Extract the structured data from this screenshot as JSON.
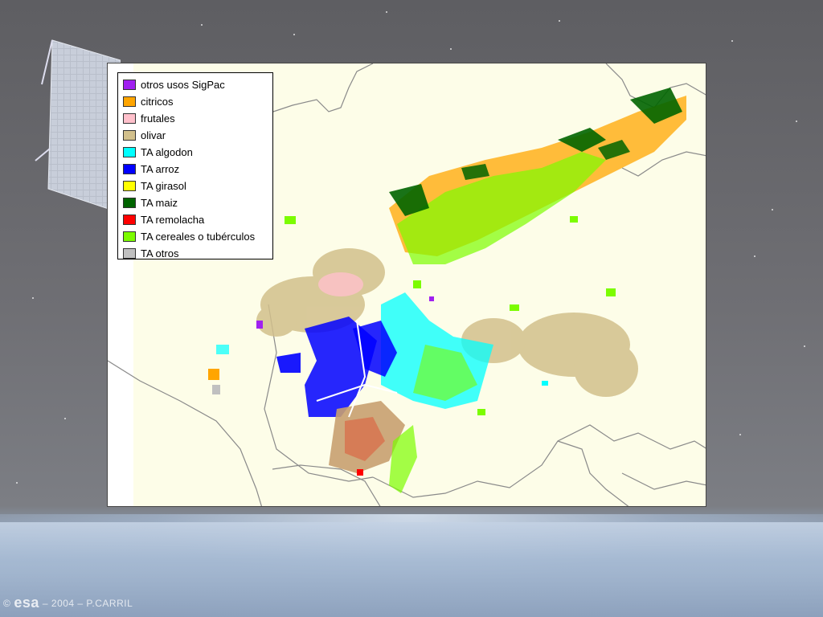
{
  "map": {
    "legend": [
      {
        "label": "otros usos SigPac",
        "color": "#a020f0"
      },
      {
        "label": "citricos",
        "color": "#ffa500"
      },
      {
        "label": "frutales",
        "color": "#ffc0cb"
      },
      {
        "label": "olivar",
        "color": "#d2c08c"
      },
      {
        "label": "TA algodon",
        "color": "#00ffff"
      },
      {
        "label": "TA arroz",
        "color": "#0000ff"
      },
      {
        "label": "TA girasol",
        "color": "#ffff00"
      },
      {
        "label": "TA maiz",
        "color": "#006400"
      },
      {
        "label": "TA remolacha",
        "color": "#ff0000"
      },
      {
        "label": "TA cereales o tubérculos",
        "color": "#7cfc00"
      },
      {
        "label": "TA otros",
        "color": "#c0c0c0"
      }
    ]
  },
  "credit": {
    "copyright": "©",
    "logo": "esa",
    "text": "– 2004 – P.CARRIL"
  }
}
